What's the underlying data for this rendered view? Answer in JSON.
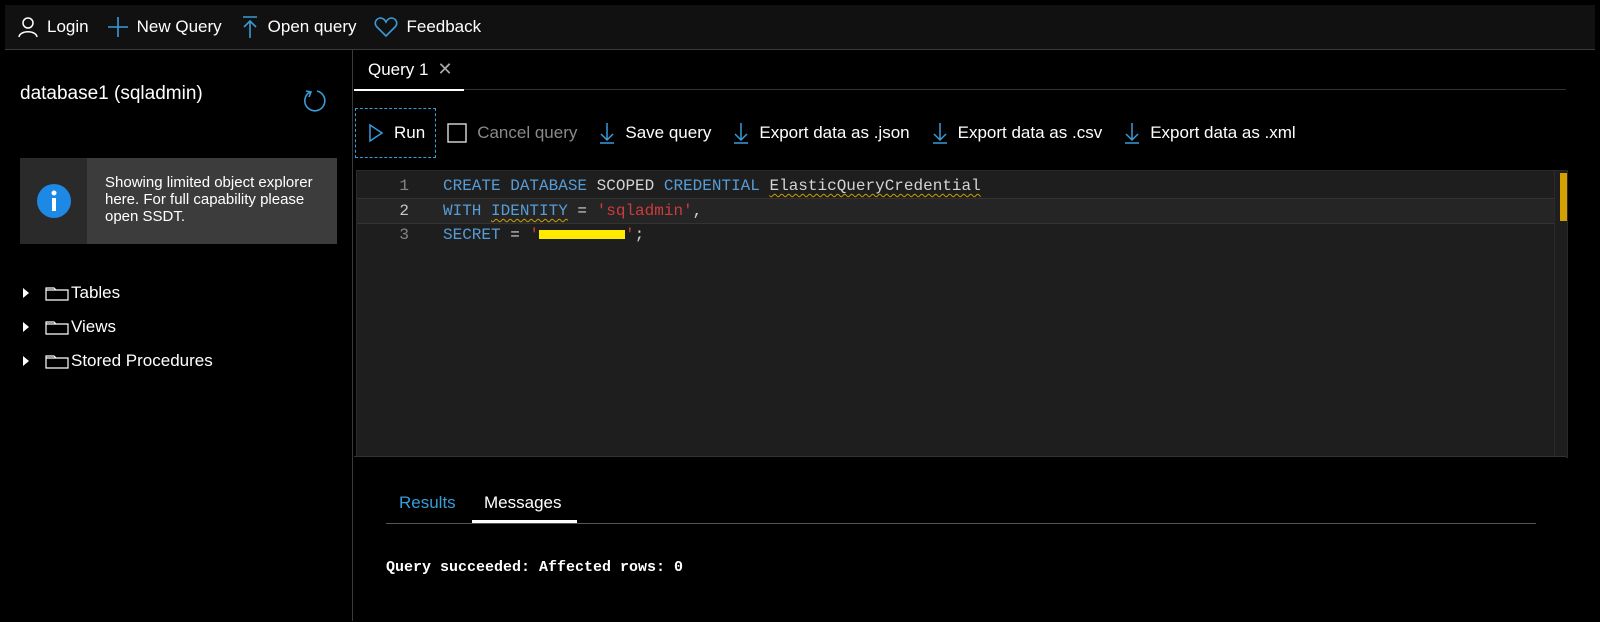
{
  "topbar": {
    "login_label": "Login",
    "new_query_label": "New Query",
    "open_query_label": "Open query",
    "feedback_label": "Feedback"
  },
  "sidebar": {
    "db_title": "database1 (sqladmin)",
    "info_message": "Showing limited object explorer here. For full capability please open SSDT.",
    "tree": [
      {
        "label": "Tables"
      },
      {
        "label": "Views"
      },
      {
        "label": "Stored Procedures"
      }
    ]
  },
  "tabs": {
    "query_tab_label": "Query 1",
    "close_glyph": "✕"
  },
  "toolbar": {
    "run_label": "Run",
    "cancel_label": "Cancel query",
    "save_label": "Save query",
    "export_json_label": "Export data as .json",
    "export_csv_label": "Export data as .csv",
    "export_xml_label": "Export data as .xml"
  },
  "editor": {
    "line_numbers": [
      "1",
      "2",
      "3"
    ],
    "line1": {
      "k1": "CREATE",
      "k2": "DATABASE",
      "k3": "SCOPED",
      "k4": "CREDENTIAL",
      "name": "ElasticQueryCredential"
    },
    "line2": {
      "k1": "WITH",
      "k2": "IDENTITY",
      "eq": " = ",
      "str": "'sqladmin'",
      "tail": ","
    },
    "line3": {
      "k1": "SECRET",
      "eq": " = ",
      "str_open": "'",
      "str_close": "'",
      "tail": ";"
    }
  },
  "results": {
    "tab_results": "Results",
    "tab_messages": "Messages",
    "message": "Query succeeded: Affected rows: 0"
  },
  "colors": {
    "accent": "#3a9bd9",
    "keyword": "#569cd6",
    "string": "#ce3b3b",
    "redaction": "#ffeb00"
  }
}
